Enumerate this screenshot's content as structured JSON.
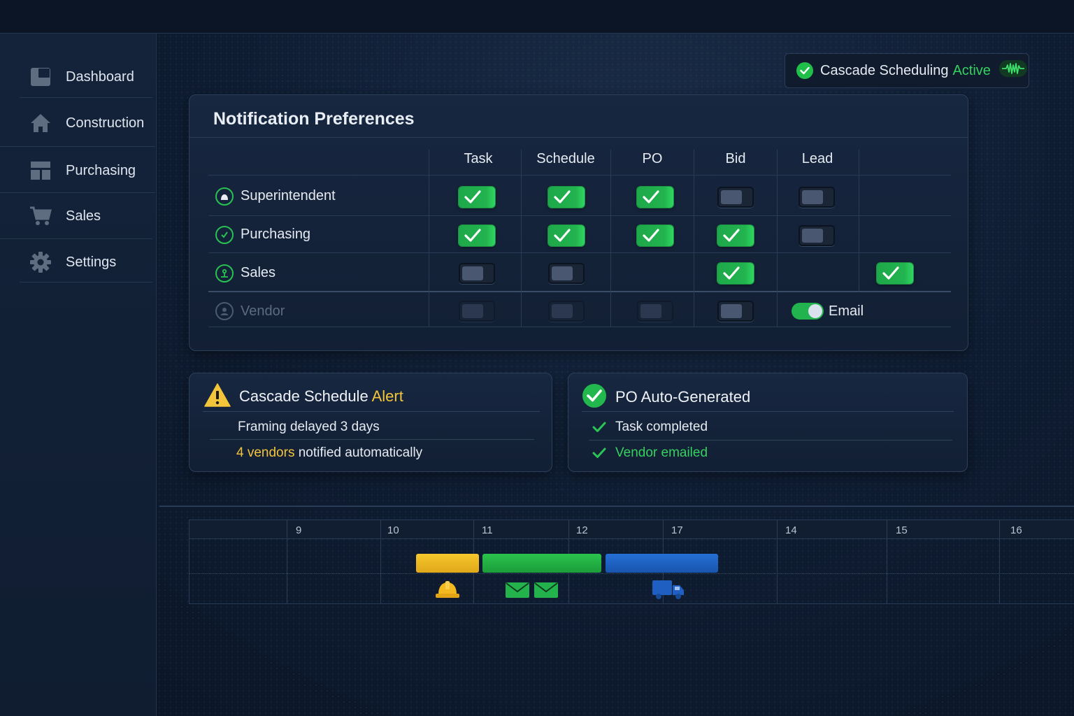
{
  "sidebar": {
    "items": [
      {
        "label": "Dashboard",
        "icon": "dashboard-icon"
      },
      {
        "label": "Construction",
        "icon": "home-icon"
      },
      {
        "label": "Purchasing",
        "icon": "layout-icon"
      },
      {
        "label": "Sales",
        "icon": "cart-icon"
      },
      {
        "label": "Settings",
        "icon": "gear-icon"
      }
    ]
  },
  "status": {
    "label": "Cascade Scheduling",
    "state": "Active",
    "icon": "waveform-icon"
  },
  "notifications": {
    "title": "Notification Preferences",
    "columns": [
      "Task",
      "Schedule",
      "PO",
      "Bid",
      "Lead"
    ],
    "rows": [
      {
        "role": "Superintendent",
        "toggles": [
          true,
          true,
          true,
          false,
          false
        ]
      },
      {
        "role": "Purchasing",
        "toggles": [
          true,
          true,
          true,
          true,
          false
        ]
      },
      {
        "role": "Sales",
        "toggles": [
          false,
          false,
          null,
          true,
          null,
          true
        ]
      },
      {
        "role": "Vendor",
        "toggles": [
          false,
          false,
          false,
          false
        ]
      }
    ],
    "email_label": "Email",
    "email_enabled": true
  },
  "alert": {
    "title": "Cascade Schedule",
    "title_accent": "Alert",
    "line1": "Framing delayed 3 days",
    "line2_accent": "4 vendors",
    "line2": "notified automatically"
  },
  "po": {
    "title": "PO Auto-Generated",
    "items": [
      "Task completed",
      "Vendor emailed"
    ]
  },
  "timeline": {
    "days": [
      "9",
      "10",
      "11",
      "12",
      "17",
      "14",
      "15",
      "16"
    ]
  },
  "colors": {
    "accent_green": "#35d15f",
    "accent_yellow": "#f2c53a",
    "bar_blue": "#2470d6"
  }
}
